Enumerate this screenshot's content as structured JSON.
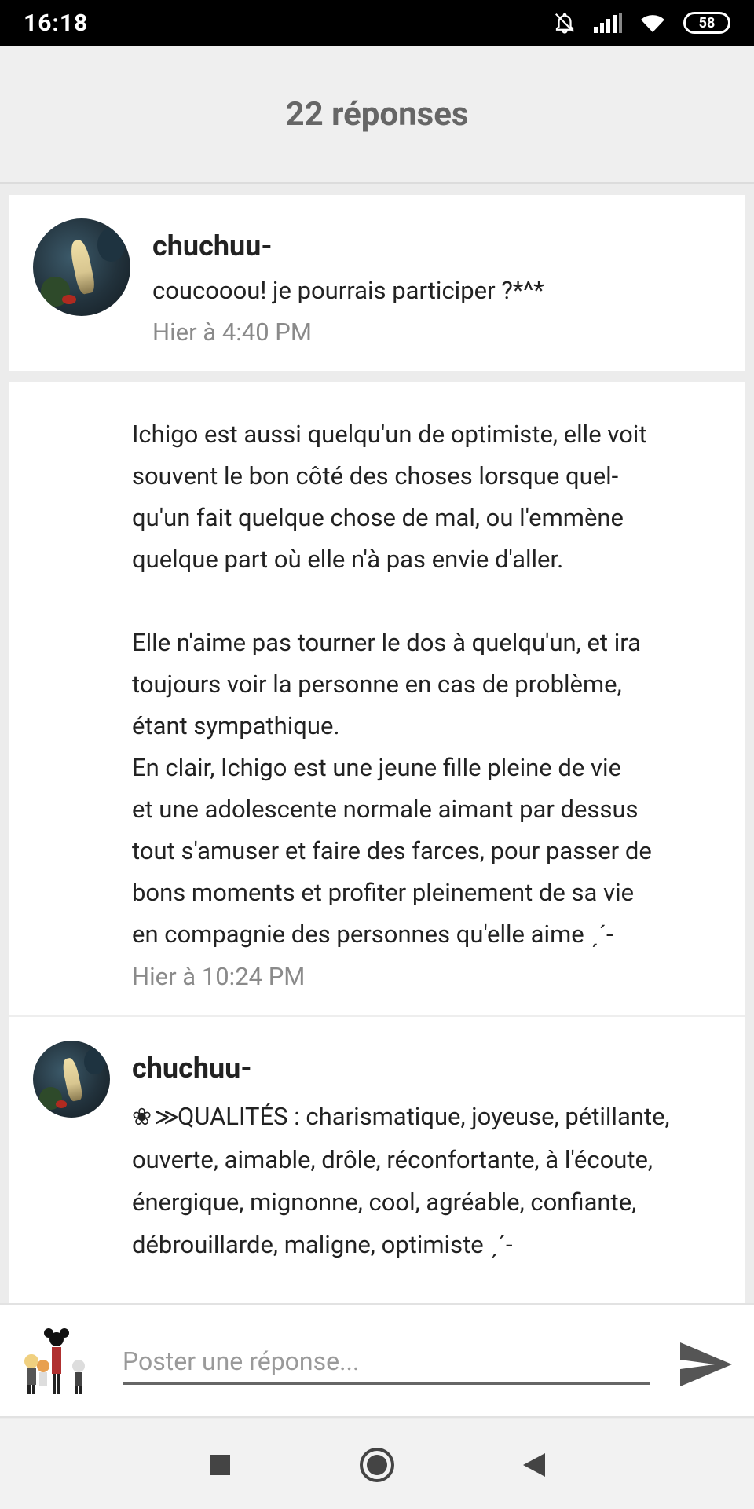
{
  "status_bar": {
    "time": "16:18",
    "battery": "58",
    "icons": [
      "bell-off-icon",
      "signal-icon",
      "wifi-icon",
      "battery-icon"
    ]
  },
  "header": {
    "title": "22 réponses"
  },
  "posts": [
    {
      "username": "chuchuu-",
      "message": "coucooou! je pourrais participer ?*^*",
      "timestamp": "Hier à 4:40 PM"
    },
    {
      "message": "Ichigo est aussi quelqu'un de optimiste, elle voit\nsouvent le bon côté des choses lorsque quel-\nqu'un fait quelque chose de mal, ou l'emmène\nquelque part où elle n'à pas envie d'aller.\n\nElle n'aime pas tourner le dos à quelqu'un, et ira\ntoujours voir la personne en cas de problème,\nétant sympathique.\nEn clair, Ichigo est une jeune fille pleine de vie\net une adolescente normale aimant par dessus\ntout s'amuser et faire des farces, pour passer de\nbons moments et profiter pleinement de sa vie\nen compagnie des personnes qu'elle aime ˏˊ-",
      "timestamp": "Hier à 10:24 PM"
    },
    {
      "username": "chuchuu-",
      "deco": "❀ ≫",
      "message": "QUALITÉS :  charismatique, joyeuse, pétillante, ouverte, aimable, drôle, réconfortante, à l'écoute, énergique, mignonne, cool, agréable, confiante, débrouillarde, maligne, optimiste ˏˊ-"
    }
  ],
  "reply": {
    "placeholder": "Poster une réponse..."
  },
  "nav": {
    "icons": [
      "recents-square-icon",
      "home-circle-icon",
      "back-triangle-icon"
    ]
  },
  "colors": {
    "header_bg": "#efefef",
    "header_text": "#666666",
    "timestamp": "#8a8a8a",
    "card_bg": "#ffffff",
    "page_bg": "#ececec"
  }
}
